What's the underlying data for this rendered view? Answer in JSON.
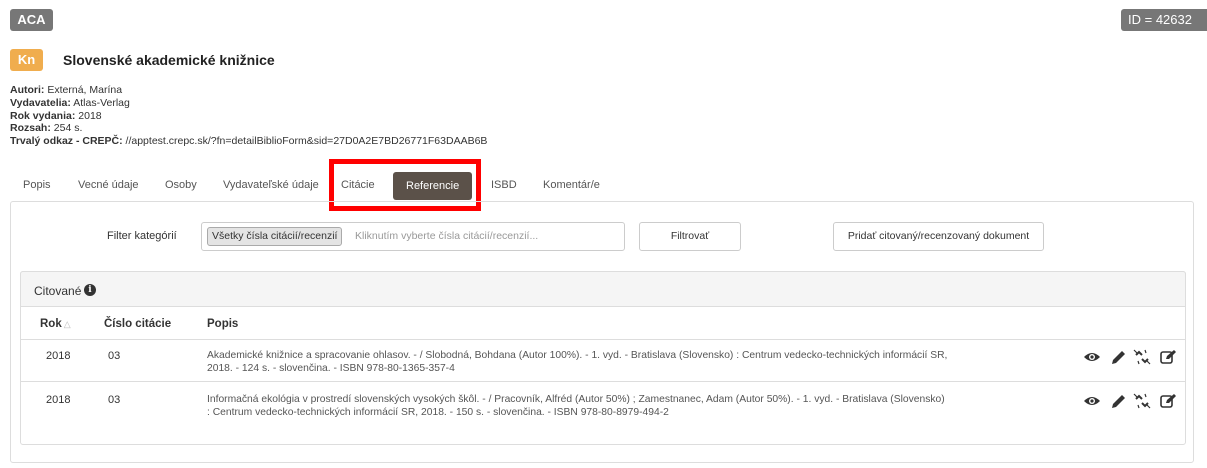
{
  "header": {
    "system_badge": "ACA",
    "id_badge": "ID = 42632",
    "type_badge": "Kn",
    "title": "Slovenské akademické knižnice"
  },
  "meta": {
    "authors_label": "Autori:",
    "authors_value": "Externá, Marína",
    "publishers_label": "Vydavatelia:",
    "publishers_value": "Atlas-Verlag",
    "year_label": "Rok vydania:",
    "year_value": "2018",
    "extent_label": "Rozsah:",
    "extent_value": "254 s.",
    "link_label": "Trvalý odkaz - CREPČ:",
    "link_value": "//apptest.crepc.sk/?fn=detailBiblioForm&sid=27D0A2E7BD26771F63DAAB6B"
  },
  "tabs": [
    "Popis",
    "Vecné údaje",
    "Osoby",
    "Vydavateľské údaje",
    "Citácie",
    "Referencie",
    "ISBD",
    "Komentár/e"
  ],
  "active_tab": "Referencie",
  "filter": {
    "label": "Filter kategórií",
    "chip": "Všetky čísla citácií/recenzií",
    "placeholder": "Kliknutím vyberte čísla citácií/recenzií...",
    "filter_button": "Filtrovať",
    "add_button": "Pridať citovaný/recenzovaný dokument"
  },
  "cited": {
    "title": "Citované",
    "info_icon": "info-circle-icon",
    "columns": {
      "year": "Rok",
      "number": "Číslo citácie",
      "desc": "Popis"
    },
    "rows": [
      {
        "year": "2018",
        "number": "03",
        "desc_line1": "Akademické knižnice a spracovanie ohlasov. - / Slobodná, Bohdana (Autor 100%). - 1. vyd. - Bratislava (Slovensko) : Centrum vedecko-technických informácií SR,",
        "desc_line2": "2018. - 124 s. - slovenčina. - ISBN  978-80-1365-357-4"
      },
      {
        "year": "2018",
        "number": "03",
        "desc_line1": "Informačná ekológia v prostredí slovenských vysokých škôl. - / Pracovník, Alfréd (Autor 50%) ; Zamestnanec, Adam (Autor 50%). - 1. vyd. - Bratislava (Slovensko)",
        "desc_line2": ": Centrum vedecko-technických informácií SR, 2018. - 150 s. - slovenčina. - ISBN 978-80-8979-494-2"
      }
    ],
    "row_icons": [
      "eye-icon",
      "pencil-icon",
      "unlink-icon",
      "edit-icon"
    ]
  },
  "colors": {
    "badge_gray": "#777777",
    "kn_orange": "#f0ad4e",
    "active_tab": "#5b5149",
    "highlight_red": "#ff0000"
  }
}
